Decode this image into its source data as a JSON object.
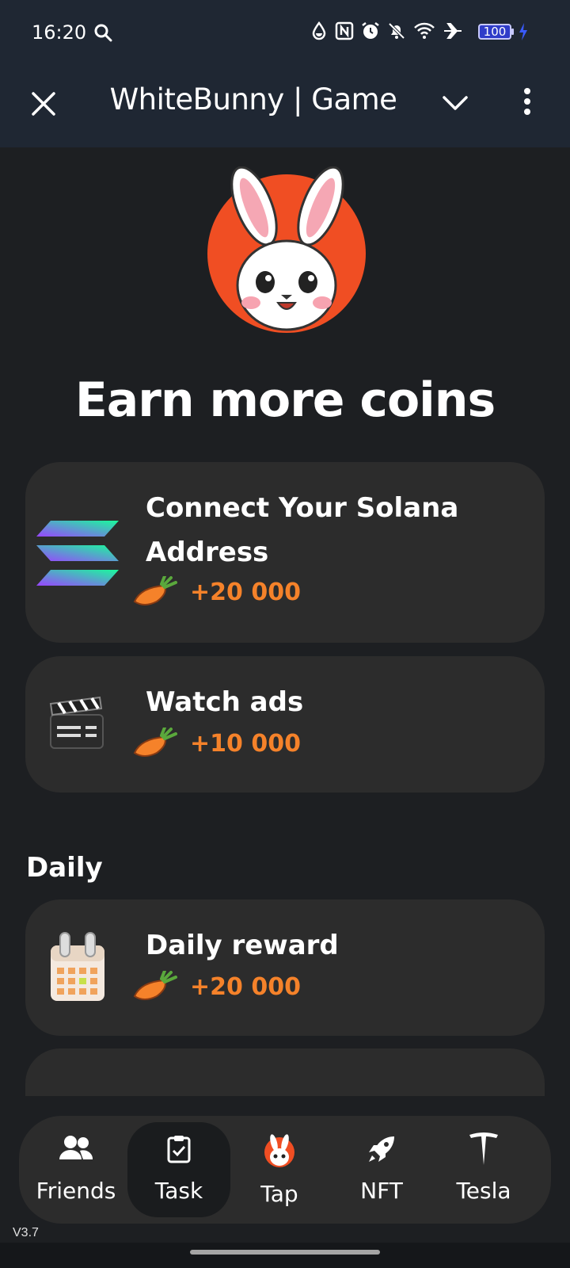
{
  "status_bar": {
    "time": "16:20",
    "battery": "100",
    "icons": [
      "search-icon",
      "data-saver-icon",
      "nfc-icon",
      "alarm-icon",
      "mute-icon",
      "wifi-icon",
      "airplane-icon",
      "battery-icon",
      "charging-icon"
    ]
  },
  "app_bar": {
    "title": "WhiteBunny | Game",
    "icons": [
      "close-icon",
      "chevron-down-icon",
      "more-vert-icon"
    ]
  },
  "headline": "Earn more coins",
  "tasks": [
    {
      "title": "Connect Your Solana Address",
      "title_line1": "Connect Your Solana",
      "title_line2": "Address",
      "reward": "+20 000",
      "icon": "solana-icon"
    },
    {
      "title": "Watch ads",
      "reward": "+10 000",
      "icon": "clapperboard-icon"
    }
  ],
  "daily": {
    "label": "Daily",
    "items": [
      {
        "title": "Daily reward",
        "reward": "+20 000",
        "icon": "calendar-icon"
      }
    ]
  },
  "nav": {
    "items": [
      {
        "label": "Friends",
        "icon": "friends-icon"
      },
      {
        "label": "Task",
        "icon": "task-icon",
        "active": true
      },
      {
        "label": "Tap",
        "icon": "bunny-icon"
      },
      {
        "label": "NFT",
        "icon": "rocket-icon"
      },
      {
        "label": "Tesla",
        "icon": "tesla-icon"
      }
    ]
  },
  "version": "V3.7",
  "colors": {
    "accent": "#f5822a",
    "card": "#2c2c2c",
    "background": "#1d1f22",
    "header": "#1f2733",
    "logo_bg": "#f04e23"
  }
}
